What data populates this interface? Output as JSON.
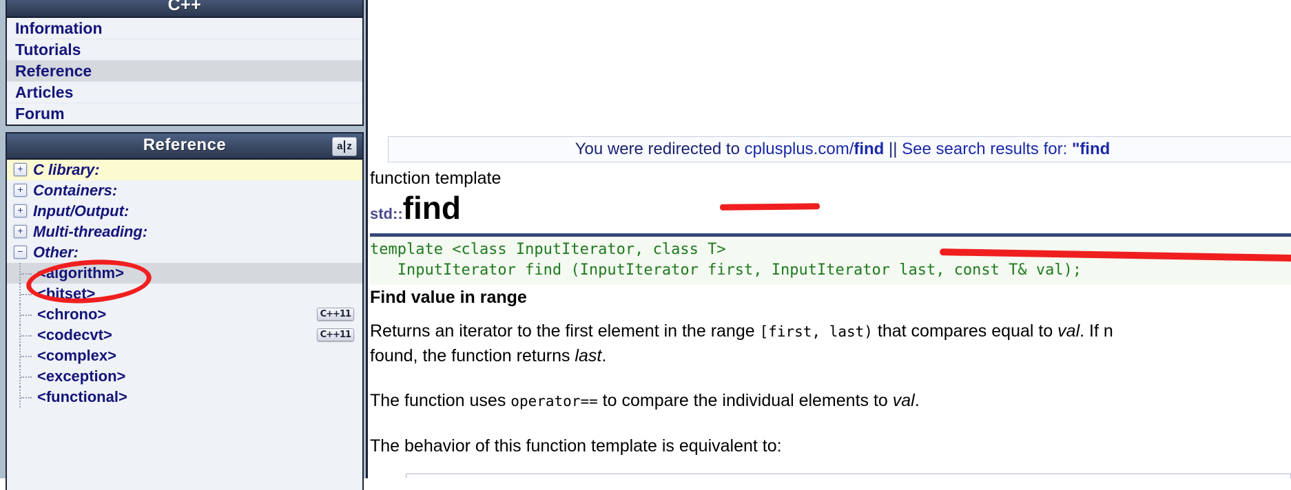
{
  "sidebar": {
    "nav_panel": {
      "title": "C++",
      "items": [
        {
          "label": "Information",
          "selected": false
        },
        {
          "label": "Tutorials",
          "selected": false
        },
        {
          "label": "Reference",
          "selected": true
        },
        {
          "label": "Articles",
          "selected": false
        },
        {
          "label": "Forum",
          "selected": false
        }
      ]
    },
    "reference_panel": {
      "title": "Reference",
      "dict_icon": {
        "name": "dictionary-az-icon",
        "left": "a",
        "right": "z"
      },
      "tree": [
        {
          "label": "C library:",
          "type": "group",
          "toggle": "+",
          "expanded": false,
          "highlight": true,
          "badge": ""
        },
        {
          "label": "Containers:",
          "type": "group",
          "toggle": "+",
          "expanded": false,
          "highlight": false,
          "badge": ""
        },
        {
          "label": "Input/Output:",
          "type": "group",
          "toggle": "+",
          "expanded": false,
          "highlight": false,
          "badge": ""
        },
        {
          "label": "Multi-threading:",
          "type": "group",
          "toggle": "+",
          "expanded": false,
          "highlight": false,
          "badge": ""
        },
        {
          "label": "Other:",
          "type": "group",
          "toggle": "−",
          "expanded": true,
          "highlight": false,
          "badge": ""
        },
        {
          "label": "<algorithm>",
          "type": "child",
          "selected": true,
          "badge": ""
        },
        {
          "label": "<bitset>",
          "type": "child",
          "selected": false,
          "badge": ""
        },
        {
          "label": "<chrono>",
          "type": "child",
          "selected": false,
          "badge": "C++11"
        },
        {
          "label": "<codecvt>",
          "type": "child",
          "selected": false,
          "badge": "C++11"
        },
        {
          "label": "<complex>",
          "type": "child",
          "selected": false,
          "badge": ""
        },
        {
          "label": "<exception>",
          "type": "child",
          "selected": false,
          "badge": ""
        },
        {
          "label": "<functional>",
          "type": "child",
          "selected": false,
          "badge": ""
        }
      ]
    }
  },
  "main": {
    "redirect_bar": {
      "prefix": "You were redirected to ",
      "site": "cplusplus.com/",
      "site_bold": "find",
      "separator": " || ",
      "suffix": "See search results for: ",
      "query": "\"find"
    },
    "kind_label": "function template",
    "namespace": "std::",
    "function_name": "find",
    "signature_line1": "template <class InputIterator, class T>",
    "signature_line2": "   InputIterator find (InputIterator first, InputIterator last, const T& val);",
    "section_heading": "Find value in range",
    "paragraph1_a": "Returns an iterator to the first element in the range ",
    "paragraph1_range": "[first, last)",
    "paragraph1_b": " that compares equal to ",
    "paragraph1_val": "val",
    "paragraph1_c": ". If n",
    "paragraph1_line2_a": "found, the function returns ",
    "paragraph1_line2_val": "last",
    "paragraph1_line2_b": ".",
    "paragraph2_a": "The function uses ",
    "paragraph2_operator": "operator==",
    "paragraph2_b": " to compare the individual elements to ",
    "paragraph2_val": "val",
    "paragraph2_c": ".",
    "paragraph3": "The behavior of this function template is equivalent to:"
  },
  "annotations": {
    "algorithm_circle": "red-ellipse-around-algorithm",
    "title_underline": "red-underline-under-std-find",
    "signature_underline": "red-underline-under-signature"
  },
  "colors": {
    "panel_header_dark": "#2b3751",
    "panel_header_light": "#4e6186",
    "sidebar_bg": "#b0bfcd",
    "panel_bg": "#eff2f7",
    "link_blue": "#14147a",
    "highlight_yellow": "#fcfad0",
    "selected_gray": "#d5d8dd",
    "code_green": "#1f7a1f",
    "code_bg": "#f4f9f1",
    "rule_blue": "#36487a",
    "annotation_red": "#f01f1f"
  }
}
